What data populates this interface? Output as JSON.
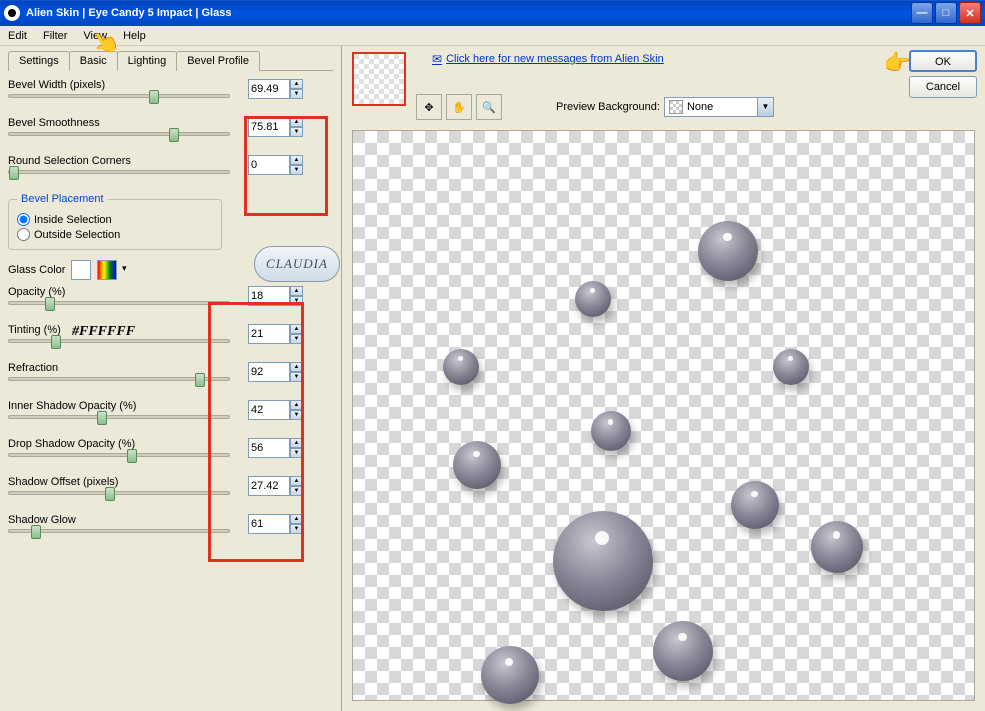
{
  "title": "Alien Skin  |  Eye Candy 5 Impact  |  Glass",
  "menu": {
    "edit": "Edit",
    "filter": "Filter",
    "view": "View",
    "help": "Help"
  },
  "tabs": {
    "settings": "Settings",
    "basic": "Basic",
    "lighting": "Lighting",
    "bevel": "Bevel Profile"
  },
  "params": {
    "bevel_width": {
      "label": "Bevel Width (pixels)",
      "value": "69.49"
    },
    "bevel_smooth": {
      "label": "Bevel Smoothness",
      "value": "75.81"
    },
    "round_corners": {
      "label": "Round Selection Corners",
      "value": "0"
    },
    "opacity": {
      "label": "Opacity (%)",
      "value": "18"
    },
    "tinting": {
      "label": "Tinting (%)",
      "value": "21"
    },
    "refraction": {
      "label": "Refraction",
      "value": "92"
    },
    "inner_shadow": {
      "label": "Inner Shadow Opacity (%)",
      "value": "42"
    },
    "drop_shadow": {
      "label": "Drop Shadow Opacity (%)",
      "value": "56"
    },
    "shadow_offset": {
      "label": "Shadow Offset (pixels)",
      "value": "27.42"
    },
    "shadow_glow": {
      "label": "Shadow Glow",
      "value": "61"
    }
  },
  "bevel_placement": {
    "legend": "Bevel Placement",
    "inside": "Inside Selection",
    "outside": "Outside Selection"
  },
  "glass_color_label": "Glass Color",
  "glass_color_hex": "#FFFFFF",
  "msg_link": "Click here for new messages from Alien Skin",
  "preview_bg_label": "Preview Background:",
  "preview_bg_value": "None",
  "buttons": {
    "ok": "OK",
    "cancel": "Cancel"
  },
  "watermark": "CLAUDIA"
}
